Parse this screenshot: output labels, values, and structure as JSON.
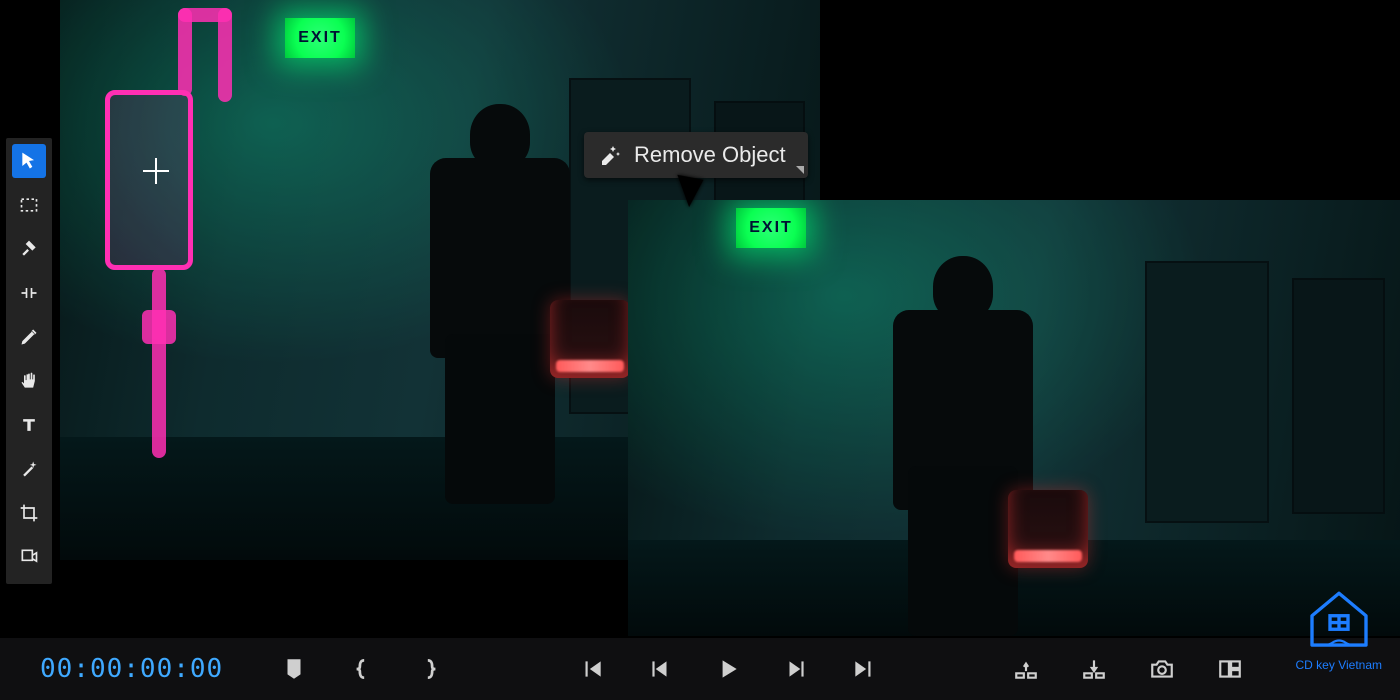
{
  "toolbar": {
    "tools": [
      {
        "name": "selection-tool",
        "active": true
      },
      {
        "name": "marquee-tool",
        "active": false
      },
      {
        "name": "razor-tool",
        "active": false
      },
      {
        "name": "ripple-edit-tool",
        "active": false
      },
      {
        "name": "pen-tool",
        "active": false
      },
      {
        "name": "hand-tool",
        "active": false
      },
      {
        "name": "type-tool",
        "active": false
      },
      {
        "name": "magic-wand-tool",
        "active": false
      },
      {
        "name": "crop-tool",
        "active": false
      },
      {
        "name": "export-tool",
        "active": false
      }
    ]
  },
  "popup": {
    "remove_object_label": "Remove Object"
  },
  "scene": {
    "exit_sign_text": "EXIT"
  },
  "transport": {
    "timecode": "00:00:00:00",
    "buttons": [
      "add-marker",
      "mark-in",
      "mark-out",
      "go-to-in",
      "step-back",
      "play",
      "step-forward",
      "go-to-out",
      "lift",
      "extract",
      "snapshot",
      "panel-layout"
    ]
  },
  "watermark": {
    "label": "CD key Vietnam"
  }
}
